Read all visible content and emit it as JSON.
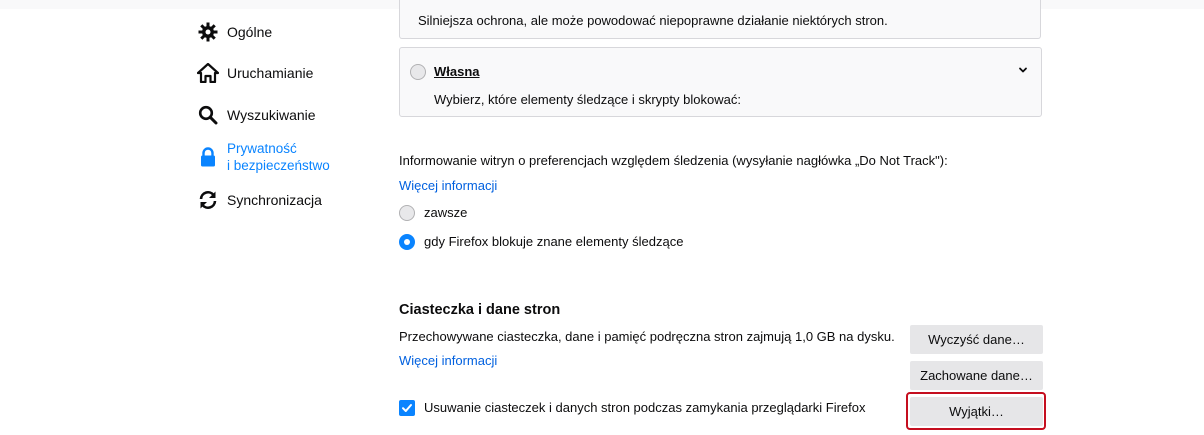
{
  "sidebar": {
    "items": [
      {
        "label": "Ogólne",
        "icon": "gear-icon"
      },
      {
        "label": "Uruchamianie",
        "icon": "home-icon"
      },
      {
        "label": "Wyszukiwanie",
        "icon": "search-icon"
      },
      {
        "label_line1": "Prywatność",
        "label_line2": "i bezpieczeństwo",
        "icon": "lock-icon",
        "active": true
      },
      {
        "label": "Synchronizacja",
        "icon": "sync-icon"
      }
    ]
  },
  "tracking": {
    "strict_description": "Silniejsza ochrona, ale może powodować niepoprawne działanie niektórych stron.",
    "custom_label": "Własna",
    "custom_description": "Wybierz, które elementy śledzące i skrypty blokować:"
  },
  "dnt": {
    "description": "Informowanie witryn o preferencjach względem śledzenia (wysyłanie nagłówka „Do Not Track\"):",
    "more_info": "Więcej informacji",
    "option_always": "zawsze",
    "option_when_blocking": "gdy Firefox blokuje znane elementy śledzące",
    "selected": "gdy Firefox blokuje znane elementy śledzące"
  },
  "cookies": {
    "heading": "Ciasteczka i dane stron",
    "description": "Przechowywane ciasteczka, dane i pamięć podręczna stron zajmują 1,0 GB na dysku.",
    "more_info": "Więcej informacji",
    "clear_button": "Wyczyść dane…",
    "manage_button": "Zachowane dane…",
    "exceptions_button": "Wyjątki…",
    "delete_on_close_label": "Usuwanie ciasteczek i danych stron podczas zamykania przeglądarki Firefox",
    "delete_on_close_checked": true
  },
  "colors": {
    "accent": "#0a84ff",
    "link": "#0060df",
    "highlight": "#c50e1f"
  }
}
